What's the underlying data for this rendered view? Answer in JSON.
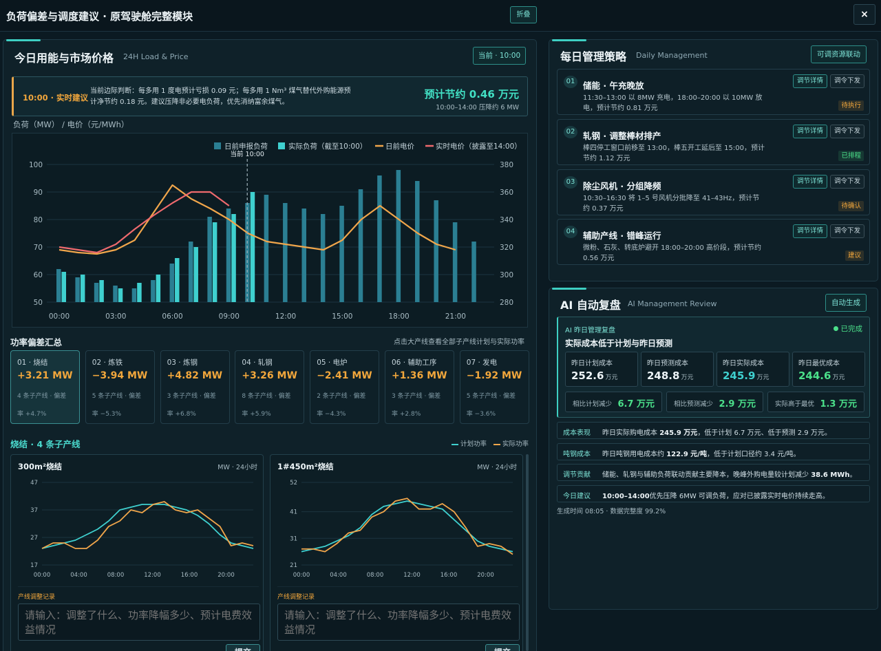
{
  "app": {
    "title": "负荷偏差与调度建议 · 原驾驶舱完整模块",
    "fold_label": "折叠",
    "close_label": "×"
  },
  "left": {
    "title": "今日用能与市场价格",
    "subtitle": "24H Load & Price",
    "now_button": "当前 · 10:00",
    "advice": {
      "label": "10:00 · 实时建议",
      "text": "当前边际判断：每多用 1 度电预计亏损 0.09 元；每多用 1 Nm³ 煤气替代外购能源预计净节约 0.18 元。建议压降非必要电负荷，优先消纳富余煤气。",
      "saving": "预计节约 0.46 万元",
      "saving_sub": "10:00–14:00 压降约 6 MW"
    },
    "axis_title": "负荷（MW） / 电价（元/MWh）",
    "chart_now_label": "当前 10:00",
    "deviation_title": "功率偏差汇总",
    "deviation_note": "点击大产线查看全部子产线计划与实际功率",
    "deviations": [
      {
        "name": "01 · 烧结",
        "value": "+3.21 MW",
        "line1": "4 条子产线 · 偏差",
        "line2": "率 +4.7%"
      },
      {
        "name": "02 · 炼铁",
        "value": "−3.94 MW",
        "line1": "5 条子产线 · 偏差",
        "line2": "率 −5.3%"
      },
      {
        "name": "03 · 炼钢",
        "value": "+4.82 MW",
        "line1": "3 条子产线 · 偏差",
        "line2": "率 +6.8%"
      },
      {
        "name": "04 · 轧钢",
        "value": "+3.26 MW",
        "line1": "8 条子产线 · 偏差",
        "line2": "率 +5.9%"
      },
      {
        "name": "05 · 电炉",
        "value": "−2.41 MW",
        "line1": "2 条子产线 · 偏差",
        "line2": "率 −4.3%"
      },
      {
        "name": "06 · 辅助工序",
        "value": "+1.36 MW",
        "line1": "3 条子产线 · 偏差",
        "line2": "率 +2.8%"
      },
      {
        "name": "07 · 发电",
        "value": "−1.92 MW",
        "line1": "5 条子产线 · 偏差",
        "line2": "率 −3.6%"
      }
    ],
    "sub_section": {
      "title": "烧结 · 4 条子产线",
      "legend_plan": "计划功率",
      "legend_actual": "实际功率"
    },
    "minis": [
      {
        "title": "300m²烧结",
        "unit": "MW · 24小时",
        "record_label": "产线调整记录",
        "placeholder": "请输入：调整了什么、功率降幅多少、预计电费效益情况",
        "submit": "提交"
      },
      {
        "title": "1#450m²烧结",
        "unit": "MW · 24小时",
        "record_label": "产线调整记录",
        "placeholder": "请输入：调整了什么、功率降幅多少、预计电费效益情况",
        "submit": "提交"
      }
    ]
  },
  "chart_data": [
    {
      "type": "bar",
      "title": "",
      "xlabel": "",
      "ylabel": "负荷（MW） / 电价（元/MWh）",
      "x": [
        0,
        1,
        2,
        3,
        4,
        5,
        6,
        7,
        8,
        9,
        10,
        11,
        12,
        13,
        14,
        15,
        16,
        17,
        18,
        19,
        20,
        21,
        22
      ],
      "xticks": [
        "00:00",
        "03:00",
        "06:00",
        "09:00",
        "12:00",
        "15:00",
        "18:00",
        "21:00"
      ],
      "ylim": [
        50,
        100
      ],
      "y2lim": [
        280,
        380
      ],
      "grid": true,
      "legend": "top-right",
      "current_hour": 10,
      "series": [
        {
          "name": "日前申报负荷",
          "kind": "bar",
          "axis": "left",
          "color": "#2b7f93",
          "values": [
            62,
            59,
            57,
            56,
            55,
            58,
            64,
            72,
            81,
            84,
            86,
            89,
            86,
            84,
            82,
            85,
            91,
            96,
            98,
            94,
            87,
            79,
            72
          ]
        },
        {
          "name": "实际负荷（截至10:00）",
          "kind": "bar",
          "axis": "left",
          "color": "#3fd0cf",
          "values": [
            61,
            60,
            58,
            55,
            57,
            60,
            66,
            70,
            79,
            82,
            90
          ]
        },
        {
          "name": "日前电价",
          "kind": "line",
          "axis": "right",
          "color": "#f1a64b",
          "values": [
            318,
            316,
            315,
            318,
            325,
            345,
            365,
            355,
            348,
            340,
            330,
            324,
            322,
            320,
            318,
            325,
            340,
            350,
            340,
            330,
            322,
            318
          ]
        },
        {
          "name": "实时电价（披露至14:00）",
          "kind": "line",
          "axis": "right",
          "color": "#ef6a6e",
          "values": [
            320,
            318,
            316,
            322,
            333,
            343,
            352,
            360,
            360,
            350
          ]
        }
      ]
    },
    {
      "type": "line",
      "title": "300m²烧结",
      "ylim": [
        17,
        47
      ],
      "yticks": [
        17,
        27,
        37,
        47
      ],
      "xticks": [
        "00:00",
        "04:00",
        "08:00",
        "12:00",
        "16:00",
        "20:00"
      ],
      "x": [
        0,
        1,
        2,
        3,
        4,
        5,
        6,
        7,
        8,
        9,
        10,
        11,
        12,
        13,
        14,
        15,
        16,
        17,
        18,
        19,
        20,
        21,
        22,
        23
      ],
      "series": [
        {
          "name": "计划功率",
          "color": "#3fd0cf",
          "values": [
            23,
            24,
            25,
            26,
            28,
            30,
            33,
            37,
            38,
            39,
            39,
            39,
            38,
            37,
            35,
            32,
            28,
            25,
            24,
            23
          ]
        },
        {
          "name": "实际功率",
          "color": "#f1a64b",
          "values": [
            23,
            25,
            25,
            23,
            23,
            26,
            31,
            33,
            37,
            36,
            39,
            40,
            37,
            36,
            37,
            34,
            31,
            24,
            25,
            24
          ]
        }
      ]
    },
    {
      "type": "line",
      "title": "1#450m²烧结",
      "ylim": [
        21,
        52
      ],
      "yticks": [
        21,
        31,
        41,
        52
      ],
      "xticks": [
        "00:00",
        "04:00",
        "08:00",
        "12:00",
        "16:00",
        "20:00"
      ],
      "series": [
        {
          "name": "计划功率",
          "color": "#3fd0cf",
          "values": [
            26,
            27,
            28,
            30,
            32,
            35,
            40,
            43,
            44,
            45,
            44,
            43,
            42,
            38,
            34,
            30,
            28,
            27,
            26
          ]
        },
        {
          "name": "实际功率",
          "color": "#f1a64b",
          "values": [
            27,
            27,
            26,
            29,
            33,
            34,
            39,
            41,
            45,
            46,
            42,
            42,
            44,
            41,
            35,
            28,
            29,
            28,
            25
          ]
        }
      ]
    }
  ],
  "right": {
    "management": {
      "title": "每日管理策略",
      "subtitle": "Daily Management",
      "link_button": "可调资源联动",
      "items": [
        {
          "num": "01",
          "title": "储能 · 午充晚放",
          "desc": "11:30–13:00 以 8MW 充电，18:00–20:00 以 10MW 放电，预计节约 0.81 万元",
          "btn1": "调节详情",
          "btn2": "调令下发",
          "badge": "待执行",
          "badge_color": "#f2a73c"
        },
        {
          "num": "02",
          "title": "轧钢 · 调整棒材排产",
          "desc": "棒四停工窗口前移至 13:00，棒五开工延后至 15:00，预计节约 1.12 万元",
          "btn1": "调节详情",
          "btn2": "调令下发",
          "badge": "已排程",
          "badge_color": "#4be08a"
        },
        {
          "num": "03",
          "title": "除尘风机 · 分组降频",
          "desc": "10:30–16:30 将 1–5 号风机分批降至 41–43Hz，预计节约 0.37 万元",
          "btn1": "调节详情",
          "btn2": "调令下发",
          "badge": "待确认",
          "badge_color": "#f2a73c"
        },
        {
          "num": "04",
          "title": "辅助产线 · 错峰运行",
          "desc": "微粉、石灰、转底炉避开 18:00–20:00 高价段，预计节约 0.56 万元",
          "btn1": "调节详情",
          "btn2": "调令下发",
          "badge": "建议",
          "badge_color": "#f2a73c"
        }
      ]
    },
    "review": {
      "title": "AI 自动复盘",
      "subtitle": "AI Management Review",
      "gen_button": "自动生成",
      "card_label": "AI 昨日管理复盘",
      "status": "已完成",
      "headline": "实际成本低于计划与昨日预测",
      "costs": [
        {
          "label": "昨日计划成本",
          "value": "252.6",
          "unit": "万元",
          "color": "#eef5f8"
        },
        {
          "label": "昨日预测成本",
          "value": "248.8",
          "unit": "万元",
          "color": "#eef5f8"
        },
        {
          "label": "昨日实际成本",
          "value": "245.9",
          "unit": "万元",
          "color": "#3fd0cf"
        },
        {
          "label": "昨日最优成本",
          "value": "244.6",
          "unit": "万元",
          "color": "#4be08a"
        }
      ],
      "diffs": [
        {
          "label": "相比计划减少",
          "value": "6.7 万元"
        },
        {
          "label": "相比预测减少",
          "value": "2.9 万元"
        },
        {
          "label": "实际高于最优",
          "value": "1.3 万元"
        }
      ],
      "rows": [
        {
          "key": "成本表现",
          "pre": "昨日实际购电成本 ",
          "bold": "245.9 万元",
          "post": "，低于计划 6.7 万元、低于预测 2.9 万元。"
        },
        {
          "key": "吨钢成本",
          "pre": "昨日吨钢用电成本约 ",
          "bold": "122.9 元/吨",
          "post": "，低于计划口径约 3.4 元/吨。"
        },
        {
          "key": "调节贡献",
          "pre": "储能、轧钢与辅助负荷联动贡献主要降本，晚峰外购电量较计划减少 ",
          "bold": "38.6 MWh",
          "post": "。"
        },
        {
          "key": "今日建议",
          "pre": "",
          "bold": "10:00–14:00",
          "post": "优先压降 6MW 可调负荷，应对已披露实时电价持续走高。"
        }
      ],
      "footer": "生成时间 08:05 · 数据完整度 99.2%"
    }
  }
}
